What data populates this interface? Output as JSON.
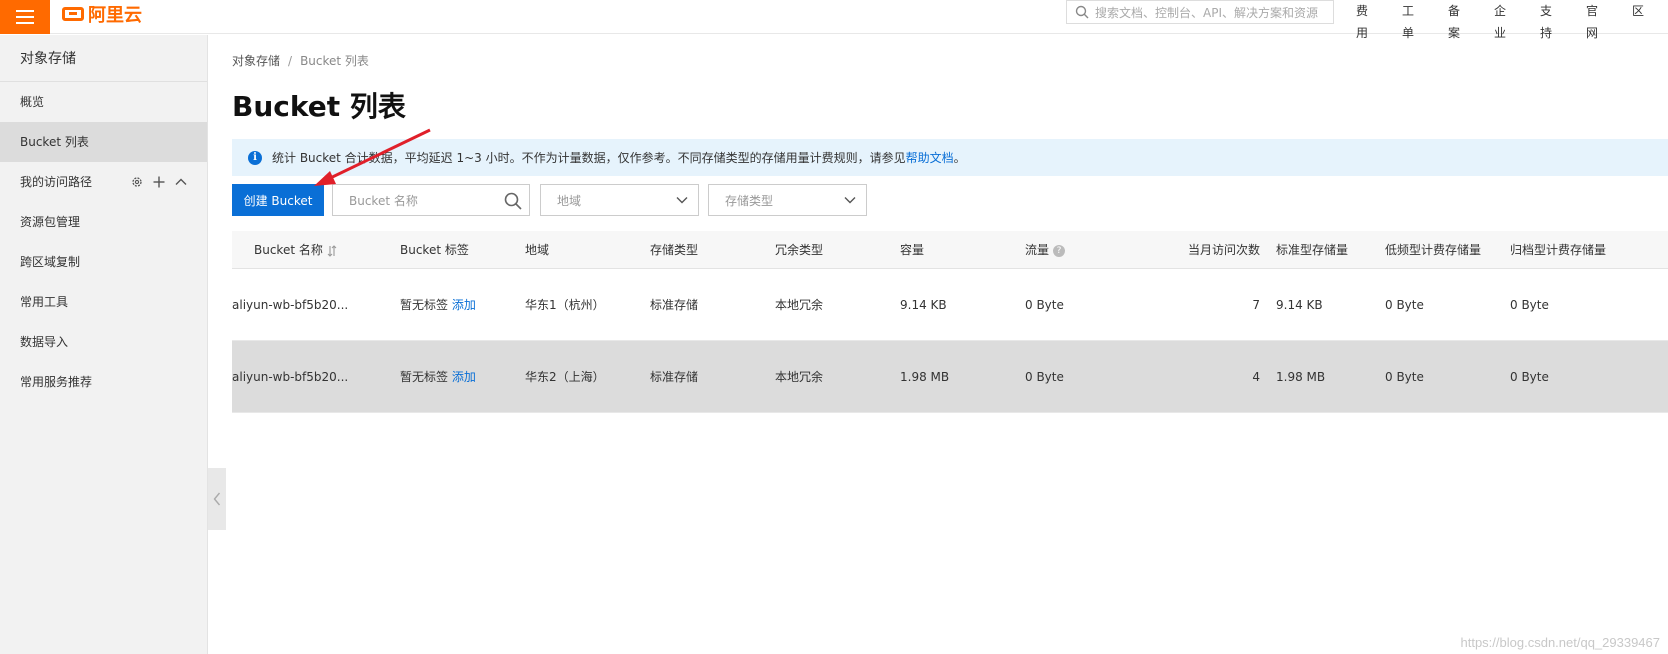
{
  "header": {
    "logo_text": "阿里云",
    "search_placeholder": "搜索文档、控制台、API、解决方案和资源",
    "nav": [
      "费用",
      "工单",
      "备案",
      "企业",
      "支持",
      "官网",
      "区"
    ]
  },
  "sidebar": {
    "title": "对象存储",
    "items": [
      {
        "label": "概览",
        "active": false
      },
      {
        "label": "Bucket 列表",
        "active": true
      },
      {
        "label": "我的访问路径",
        "active": false
      },
      {
        "label": "资源包管理",
        "active": false
      },
      {
        "label": "跨区域复制",
        "active": false
      },
      {
        "label": "常用工具",
        "active": false
      },
      {
        "label": "数据导入",
        "active": false
      },
      {
        "label": "常用服务推荐",
        "active": false
      }
    ]
  },
  "breadcrumb": {
    "root": "对象存储",
    "separator": "/",
    "current": "Bucket 列表"
  },
  "page_title": "Bucket 列表",
  "notice": {
    "text": "统计 Bucket 合计数据，平均延迟 1~3 小时。不作为计量数据，仅作参考。不同存储类型的存储用量计费规则，请参见",
    "link": "帮助文档",
    "suffix": "。"
  },
  "toolbar": {
    "create_label": "创建 Bucket",
    "name_placeholder": "Bucket 名称",
    "region_placeholder": "地域",
    "storage_type_placeholder": "存储类型"
  },
  "table": {
    "headers": [
      "Bucket 名称",
      "Bucket 标签",
      "地域",
      "存储类型",
      "冗余类型",
      "容量",
      "流量",
      "当月访问次数",
      "标准型存储量",
      "低频型计费存储量",
      "归档型计费存储量"
    ],
    "rows": [
      {
        "name": "aliyun-wb-bf5b20...",
        "tag": "暂无标签",
        "tag_action": "添加",
        "region": "华东1（杭州）",
        "storage": "标准存储",
        "redundancy": "本地冗余",
        "capacity": "9.14 KB",
        "traffic": "0 Byte",
        "visits": "7",
        "standard": "9.14 KB",
        "ia": "0 Byte",
        "archive": "0 Byte",
        "highlighted": false
      },
      {
        "name": "aliyun-wb-bf5b20...",
        "tag": "暂无标签",
        "tag_action": "添加",
        "region": "华东2（上海）",
        "storage": "标准存储",
        "redundancy": "本地冗余",
        "capacity": "1.98 MB",
        "traffic": "0 Byte",
        "visits": "4",
        "standard": "1.98 MB",
        "ia": "0 Byte",
        "archive": "0 Byte",
        "highlighted": true
      }
    ]
  },
  "watermark": "https://blog.csdn.net/qq_29339467",
  "colors": {
    "brand": "#ff6a00",
    "primary": "#0a6fd6",
    "annotation": "#e0202a"
  }
}
